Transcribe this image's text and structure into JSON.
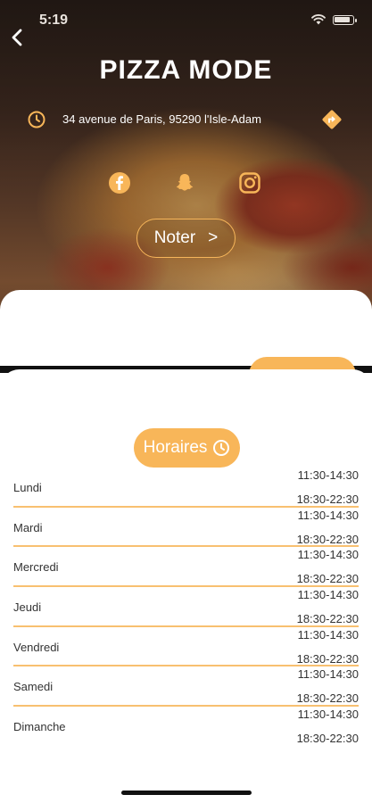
{
  "status_bar": {
    "time": "5:19"
  },
  "header": {
    "title": "PIZZA MODE",
    "address": "34 avenue de Paris, 95290 l'Isle-Adam"
  },
  "socials": [
    "facebook",
    "snapchat",
    "instagram"
  ],
  "actions": {
    "noter_label": "Noter",
    "noter_arrow": ">"
  },
  "hours": {
    "title": "Horaires",
    "days": [
      {
        "day": "Lundi",
        "slot1": "11:30-14:30",
        "slot2": "18:30-22:30"
      },
      {
        "day": "Mardi",
        "slot1": "11:30-14:30",
        "slot2": "18:30-22:30"
      },
      {
        "day": "Mercredi",
        "slot1": "11:30-14:30",
        "slot2": "18:30-22:30"
      },
      {
        "day": "Jeudi",
        "slot1": "11:30-14:30",
        "slot2": "18:30-22:30"
      },
      {
        "day": "Vendredi",
        "slot1": "11:30-14:30",
        "slot2": "18:30-22:30"
      },
      {
        "day": "Samedi",
        "slot1": "11:30-14:30",
        "slot2": "18:30-22:30"
      },
      {
        "day": "Dimanche",
        "slot1": "11:30-14:30",
        "slot2": "18:30-22:30"
      }
    ]
  },
  "colors": {
    "accent": "#f8b659",
    "divider": "#f8c070",
    "text": "#333333"
  }
}
